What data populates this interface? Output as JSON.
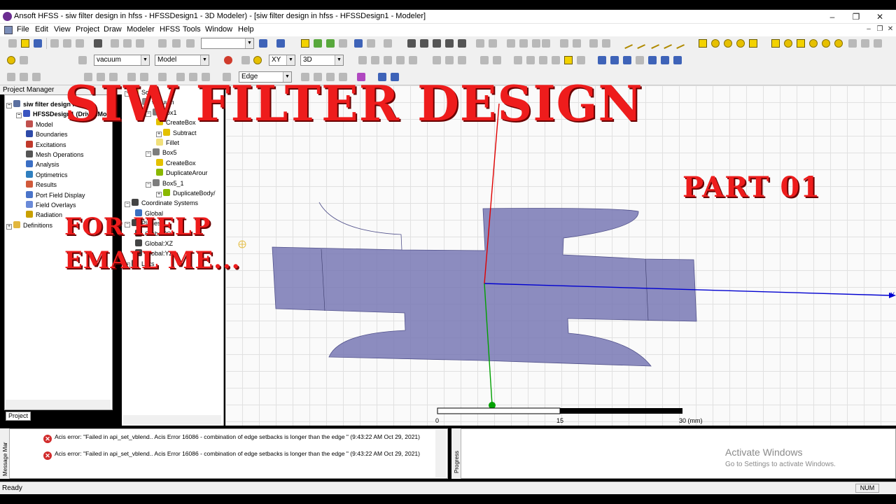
{
  "window": {
    "title": "Ansoft HFSS - siw filter design in hfss - HFSSDesign1 - 3D Modeler) - [siw filter design in hfss - HFSSDesign1 - Modeler]",
    "controls": {
      "minimize": "–",
      "maximize": "❐",
      "close": "✕"
    }
  },
  "menu": {
    "items": [
      "File",
      "Edit",
      "View",
      "Project",
      "Draw",
      "Modeler",
      "HFSS",
      "Tools",
      "Window",
      "Help"
    ],
    "mdi_controls": [
      "–",
      "❐",
      "✕"
    ]
  },
  "toolbar": {
    "material_select": "vacuum",
    "model_select": "Model",
    "plane_select": "XY",
    "dimension_select": "3D",
    "selection_mode_select": "Edge",
    "blank_select": ""
  },
  "project_manager": {
    "header": "Project Manager",
    "tab_label": "Project",
    "tree": [
      {
        "label": "siw filter design i",
        "bold": true,
        "icon": "project-icon",
        "color": "#5a6fa0",
        "indent": 0,
        "expander": "−"
      },
      {
        "label": "HFSSDesign1 (DrivenMo",
        "bold": true,
        "icon": "design-icon",
        "color": "#3a55c0",
        "indent": 1,
        "expander": "−"
      },
      {
        "label": "Model",
        "icon": "model-icon",
        "color": "#c0504d",
        "indent": 2
      },
      {
        "label": "Boundaries",
        "icon": "boundaries-icon",
        "color": "#2e4aa8",
        "indent": 2
      },
      {
        "label": "Excitations",
        "icon": "excitations-icon",
        "color": "#c0392b",
        "indent": 2
      },
      {
        "label": "Mesh Operations",
        "icon": "mesh-icon",
        "color": "#555555",
        "indent": 2
      },
      {
        "label": "Analysis",
        "icon": "analysis-icon",
        "color": "#3b6fc4",
        "indent": 2
      },
      {
        "label": "Optimetrics",
        "icon": "optimetrics-icon",
        "color": "#2f7fbf",
        "indent": 2
      },
      {
        "label": "Results",
        "icon": "results-icon",
        "color": "#d15a3a",
        "indent": 2
      },
      {
        "label": "Port Field Display",
        "icon": "port-field-icon",
        "color": "#4a74c9",
        "indent": 2
      },
      {
        "label": "Field Overlays",
        "icon": "field-overlays-icon",
        "color": "#6a8ad8",
        "indent": 2
      },
      {
        "label": "Radiation",
        "icon": "radiation-icon",
        "color": "#c9a000",
        "indent": 2
      },
      {
        "label": "Definitions",
        "icon": "folder-icon",
        "color": "#e2b73e",
        "indent": 0,
        "expander": "+"
      }
    ]
  },
  "history_tree": {
    "items": [
      {
        "label": "Solids",
        "indent": 0,
        "expander": "−",
        "icon": "folder-icon",
        "color": "#e2b73e"
      },
      {
        "label": "vacuum",
        "indent": 1,
        "expander": "−",
        "icon": "material-icon",
        "color": "#888888"
      },
      {
        "label": "Box1",
        "indent": 2,
        "expander": "−",
        "icon": "solid-icon",
        "color": "#7d7d7d"
      },
      {
        "label": "CreateBox",
        "indent": 3,
        "icon": "createbox-icon",
        "color": "#e3c100"
      },
      {
        "label": "Subtract",
        "indent": 3,
        "expander": "+",
        "icon": "subtract-icon",
        "color": "#e3c100"
      },
      {
        "label": "Fillet",
        "indent": 3,
        "icon": "fillet-icon",
        "color": "#f1e07a"
      },
      {
        "label": "Box5",
        "indent": 2,
        "expander": "−",
        "icon": "solid-icon",
        "color": "#7d7d7d"
      },
      {
        "label": "CreateBox",
        "indent": 3,
        "icon": "createbox-icon",
        "color": "#e3c100"
      },
      {
        "label": "DuplicateArour",
        "indent": 3,
        "icon": "duplicate-icon",
        "color": "#8ab800"
      },
      {
        "label": "Box5_1",
        "indent": 2,
        "expander": "−",
        "icon": "solid-icon",
        "color": "#7d7d7d"
      },
      {
        "label": "DuplicateBody/",
        "indent": 3,
        "expander": "+",
        "icon": "duplicate-icon",
        "color": "#8ab800"
      },
      {
        "label": "Coordinate Systems",
        "indent": 0,
        "expander": "−",
        "icon": "coord-icon",
        "color": "#444444"
      },
      {
        "label": "Global",
        "indent": 1,
        "icon": "global-icon",
        "color": "#3a6fc0"
      },
      {
        "label": "Planes",
        "indent": 0,
        "expander": "−",
        "icon": "plane-icon",
        "color": "#444444"
      },
      {
        "label": "Global:XY",
        "indent": 1,
        "icon": "plane-icon",
        "color": "#444444"
      },
      {
        "label": "Global:XZ",
        "indent": 1,
        "icon": "plane-icon",
        "color": "#444444"
      },
      {
        "label": "Global:YZ",
        "indent": 1,
        "icon": "plane-icon",
        "color": "#444444"
      },
      {
        "label": "Lists",
        "indent": 0,
        "expander": "+",
        "icon": "list-icon",
        "color": "#444444"
      }
    ]
  },
  "overlay": {
    "title": "SIW FILTER DESIGN",
    "part": "PART 01",
    "help_line1": "FOR HELP",
    "help_line2": "EMAIL ME...",
    "color": "#ee1c1c"
  },
  "viewport": {
    "shape_color": "#7878b4",
    "axis_y_label": "Y",
    "axis_colors": {
      "x": "#00a000",
      "y": "#0000d0",
      "z": "#e00000"
    },
    "ruler": {
      "ticks": [
        "0",
        "15",
        "30 (mm)"
      ]
    }
  },
  "messages": {
    "strip_label": "Message Mar",
    "items": [
      {
        "text": "Acis error: \"Failed in api_set_vblend.. Acis Error 16086 - combination of edge setbacks is longer than the edge \" (9:43:22 AM  Oct 29, 2021)"
      },
      {
        "text": "Acis error: \"Failed in api_set_vblend.. Acis Error 16086 - combination of edge setbacks is longer than the edge \" (9:43:22 AM  Oct 29, 2021)"
      }
    ]
  },
  "progress": {
    "strip_label": "Progress",
    "watermark_title": "Activate Windows",
    "watermark_sub": "Go to Settings to activate Windows."
  },
  "status": {
    "text": "Ready",
    "num": "NUM"
  }
}
